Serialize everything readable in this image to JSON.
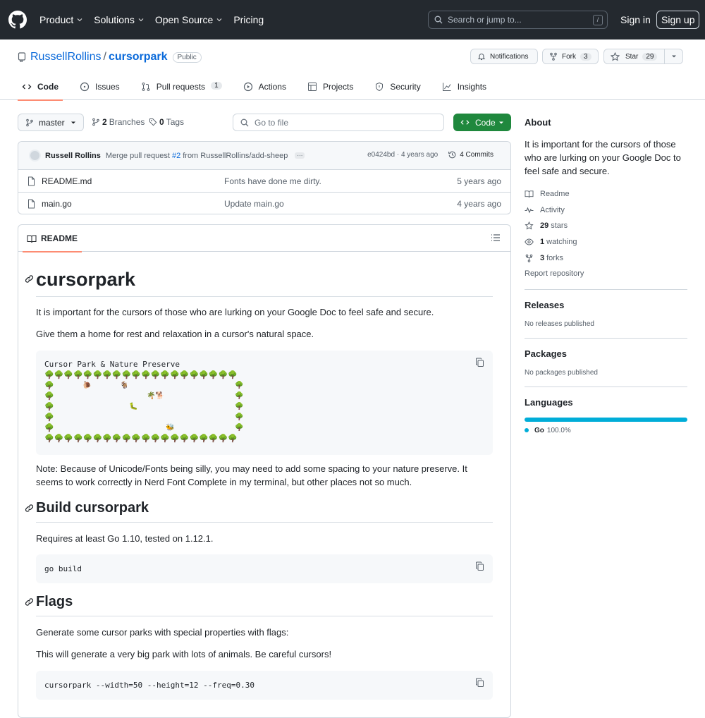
{
  "header": {
    "nav": [
      "Product",
      "Solutions",
      "Open Source",
      "Pricing"
    ],
    "search_placeholder": "Search or jump to...",
    "search_shortcut": "/",
    "signin": "Sign in",
    "signup": "Sign up"
  },
  "repo": {
    "owner": "RussellRollins",
    "sep": "/",
    "name": "cursorpark",
    "visibility": "Public",
    "notifications_label": "Notifications",
    "fork_label": "Fork",
    "fork_count": "3",
    "star_label": "Star",
    "star_count": "29"
  },
  "tabs": [
    {
      "label": "Code"
    },
    {
      "label": "Issues"
    },
    {
      "label": "Pull requests",
      "count": "1"
    },
    {
      "label": "Actions"
    },
    {
      "label": "Projects"
    },
    {
      "label": "Security"
    },
    {
      "label": "Insights"
    }
  ],
  "toolbar": {
    "branch": "master",
    "branches_count": "2",
    "branches_label": "Branches",
    "tags_count": "0",
    "tags_label": "Tags",
    "goto_placeholder": "Go to file",
    "code_label": "Code"
  },
  "commit": {
    "author": "Russell Rollins",
    "msg_prefix": "Merge pull request",
    "pr": "#2",
    "msg_suffix": "from RussellRollins/add-sheep",
    "sha_time": "e0424bd · 4 years ago",
    "commits": "4 Commits"
  },
  "files": [
    {
      "name": "README.md",
      "msg": "Fonts have done me dirty.",
      "age": "5 years ago"
    },
    {
      "name": "main.go",
      "msg": "Update main.go",
      "age": "4 years ago"
    }
  ],
  "readme": {
    "tab_label": "README",
    "h1": "cursorpark",
    "p1": "It is important for the cursors of those who are lurking on your Google Doc to feel safe and secure.",
    "p2": "Give them a home for rest and relaxation in a cursor's natural space.",
    "park_title": "Cursor Park & Nature Preserve",
    "note": "Note: Because of Unicode/Fonts being silly, you may need to add some spacing to your nature preserve. It seems to work correctly in Nerd Font Complete in my terminal, but other places not so much.",
    "h2_build": "Build cursorpark",
    "p_build": "Requires at least Go 1.10, tested on 1.12.1.",
    "code_build": "go build",
    "h2_flags": "Flags",
    "p_flags1": "Generate some cursor parks with special properties with flags:",
    "p_flags2": "This will generate a very big park with lots of animals. Be careful cursors!",
    "code_flags": "cursorpark --width=50 --height=12 --freq=0.30"
  },
  "about": {
    "title": "About",
    "description": "It is important for the cursors of those who are lurking on your Google Doc to feel safe and secure.",
    "readme": "Readme",
    "activity": "Activity",
    "stars_count": "29",
    "stars_label": "stars",
    "watching_count": "1",
    "watching_label": "watching",
    "forks_count": "3",
    "forks_label": "forks",
    "report": "Report repository"
  },
  "releases": {
    "title": "Releases",
    "empty": "No releases published"
  },
  "packages": {
    "title": "Packages",
    "empty": "No packages published"
  },
  "languages": {
    "title": "Languages",
    "name": "Go",
    "percent": "100.0%",
    "go_share": 1.0
  },
  "colors": {
    "header_bg": "#24292f",
    "link": "#0969da",
    "primary_btn": "#1f883d",
    "go_lang": "#00add8",
    "active_tab": "#fd8c73"
  }
}
